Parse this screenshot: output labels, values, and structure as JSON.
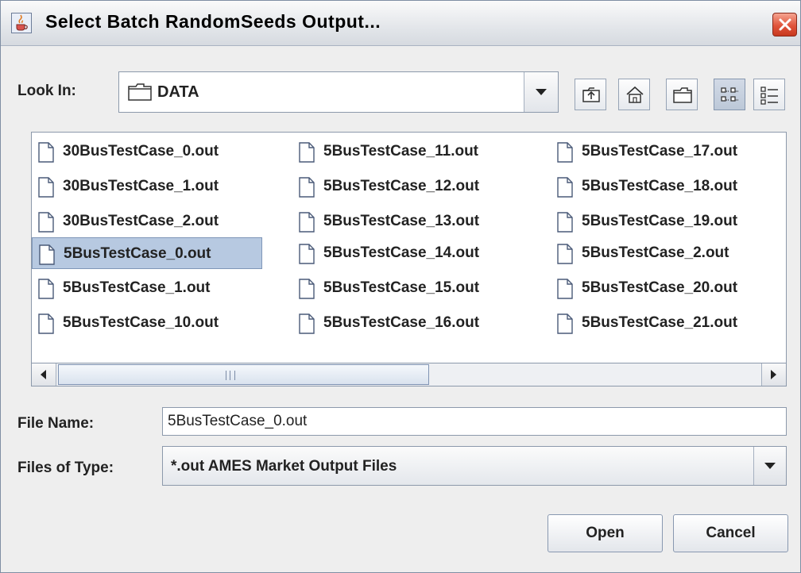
{
  "window": {
    "title": "Select Batch RandomSeeds Output..."
  },
  "look_in": {
    "label": "Look In:",
    "value": "DATA"
  },
  "toolbar": {
    "buttons": [
      "up-folder-icon",
      "home-icon",
      "new-folder-icon",
      "list-view-icon",
      "details-view-icon"
    ],
    "active_view": "list"
  },
  "files": {
    "selected": "5BusTestCase_0.out",
    "columns": [
      [
        "30BusTestCase_0.out",
        "30BusTestCase_1.out",
        "30BusTestCase_2.out",
        "5BusTestCase_0.out",
        "5BusTestCase_1.out",
        "5BusTestCase_10.out"
      ],
      [
        "5BusTestCase_11.out",
        "5BusTestCase_12.out",
        "5BusTestCase_13.out",
        "5BusTestCase_14.out",
        "5BusTestCase_15.out",
        "5BusTestCase_16.out"
      ],
      [
        "5BusTestCase_17.out",
        "5BusTestCase_18.out",
        "5BusTestCase_19.out",
        "5BusTestCase_2.out",
        "5BusTestCase_20.out",
        "5BusTestCase_21.out"
      ]
    ]
  },
  "file_name": {
    "label": "File Name:",
    "value": "5BusTestCase_0.out"
  },
  "files_of_type": {
    "label": "Files of Type:",
    "value": "*.out AMES Market Output Files"
  },
  "buttons": {
    "open": "Open",
    "cancel": "Cancel"
  },
  "colors": {
    "selection": "#b7c9e1",
    "close_button": "#e0543b",
    "window_bg": "#eeeeee"
  }
}
